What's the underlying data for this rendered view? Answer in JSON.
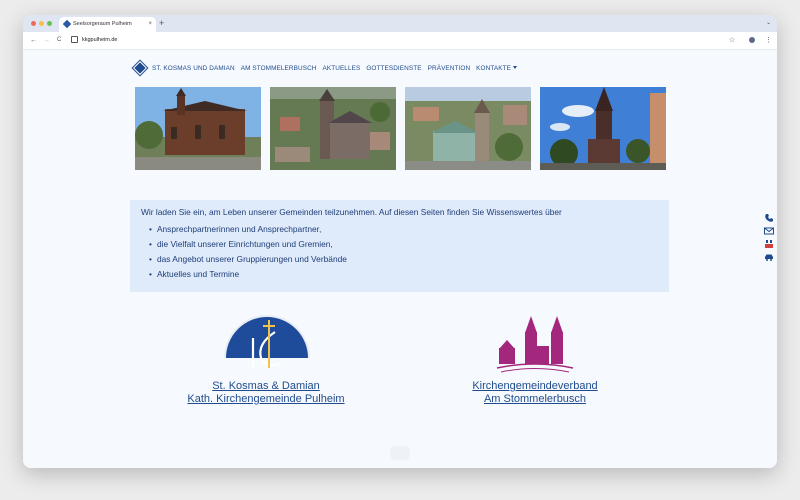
{
  "browser": {
    "tab_title": "Seelsorgeraum Pulheim",
    "tab_close": "×",
    "new_tab": "+",
    "tab_menu": "⌄",
    "back": "←",
    "forward": "→",
    "reload": "C",
    "url": "kkgpulheim.de",
    "star": "☆",
    "menu": "⋮"
  },
  "nav": {
    "items": [
      "ST. KOSMAS UND DAMIAN",
      "AM STOMMELERBUSCH",
      "AKTUELLES",
      "GOTTESDIENSTE",
      "PRÄVENTION",
      "KONTAKTE"
    ]
  },
  "intro": {
    "lead": "Wir laden Sie ein, am Leben unserer Gemeinden teilzunehmen. Auf diesen Seiten finden Sie Wissenswertes über",
    "bullets": [
      "Ansprechpartnerinnen und Ansprechpartner,",
      "die Vielfalt unserer Einrichtungen und Gremien,",
      "das Angebot unserer Gruppierungen und Verbände",
      "Aktuelles und Termine"
    ]
  },
  "orgs": [
    {
      "line1": "St. Kosmas & Damian",
      "line2": "Kath. Kirchengemeinde Pulheim"
    },
    {
      "line1": "Kirchengemeindeverband",
      "line2": "Am Stommelerbusch"
    }
  ],
  "colors": {
    "accent": "#1f4c8f",
    "magenta": "#a3287d",
    "intro_bg": "#dfeafb"
  },
  "side_icons": [
    "phone-icon",
    "mail-icon",
    "pdf-icon",
    "car-icon"
  ]
}
